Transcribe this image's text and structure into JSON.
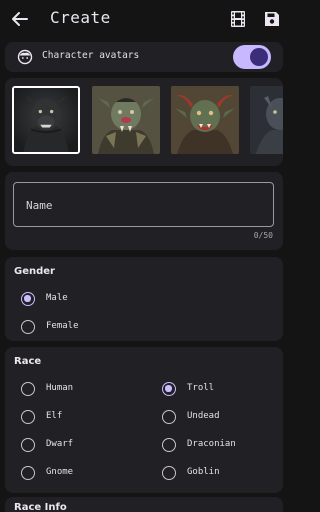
{
  "header": {
    "title": "Create",
    "back_icon": "arrow-left-icon",
    "film_icon": "film-icon",
    "save_icon": "save-icon"
  },
  "avatar_toggle": {
    "label": "Character avatars",
    "enabled": true,
    "icon": "face-icon"
  },
  "avatars": [
    {
      "name": "werewolf",
      "selected": true
    },
    {
      "name": "orc-warrior",
      "selected": false
    },
    {
      "name": "horned-troll",
      "selected": false
    },
    {
      "name": "dark-troll",
      "selected": false
    }
  ],
  "name_field": {
    "placeholder": "Name",
    "counter": "0/50"
  },
  "gender": {
    "title": "Gender",
    "options": [
      {
        "label": "Male",
        "selected": true
      },
      {
        "label": "Female",
        "selected": false
      }
    ]
  },
  "race": {
    "title": "Race",
    "options": [
      {
        "label": "Human",
        "selected": false
      },
      {
        "label": "Troll",
        "selected": true
      },
      {
        "label": "Elf",
        "selected": false
      },
      {
        "label": "Undead",
        "selected": false
      },
      {
        "label": "Dwarf",
        "selected": false
      },
      {
        "label": "Draconian",
        "selected": false
      },
      {
        "label": "Gnome",
        "selected": false
      },
      {
        "label": "Goblin",
        "selected": false
      }
    ]
  },
  "race_info": {
    "title": "Race Info"
  },
  "colors": {
    "background": "#141414",
    "card": "#212024",
    "accent": "#cbbcff",
    "switch_track": "#c8b8ff",
    "switch_thumb": "#3c2d7a"
  }
}
